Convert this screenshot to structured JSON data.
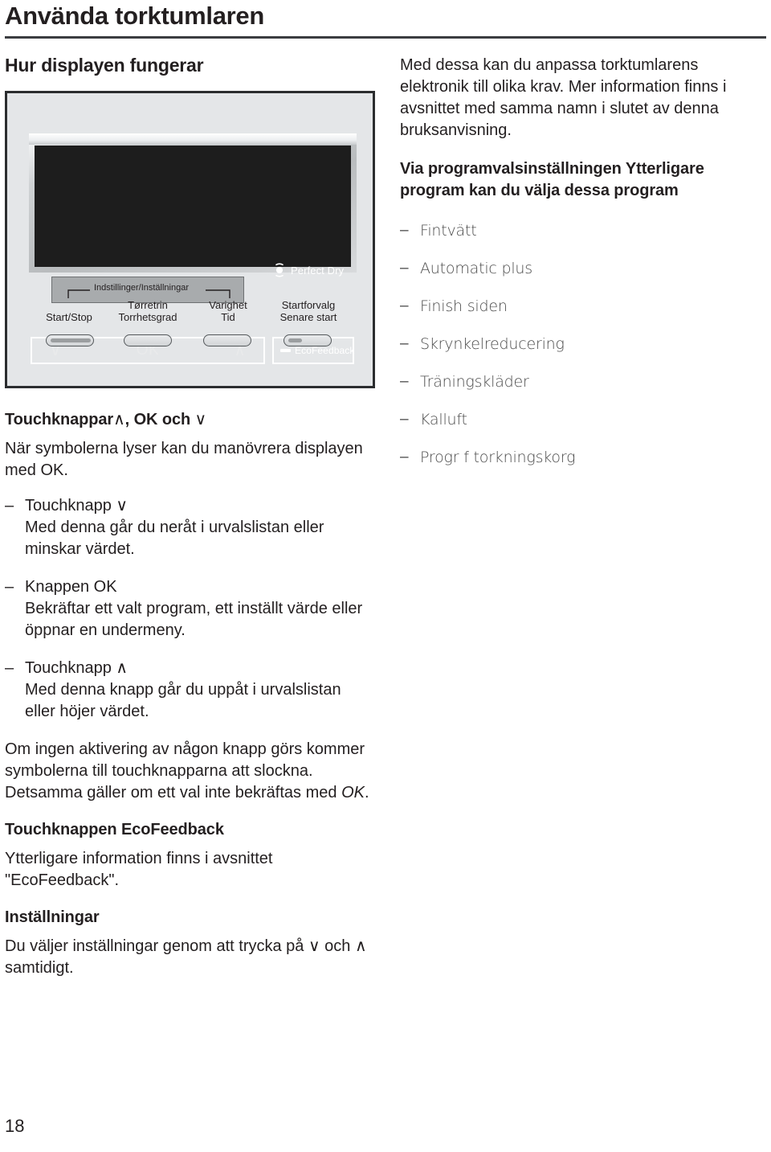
{
  "page": {
    "title": "Använda torktumlaren",
    "number": "18"
  },
  "left": {
    "heading": "Hur displayen fungerar",
    "illustration": {
      "perfect_dry_label": "Perfect Dry",
      "eco_feedback_label": "EcoFeedback",
      "touch_down": "∨",
      "touch_ok": "OK",
      "touch_up": "∧",
      "bracket_label": "Indstillinger/Inställningar",
      "controls": [
        {
          "line1": "",
          "line2": "Start/Stop"
        },
        {
          "line1": "Tørretrin",
          "line2": "Torrhetsgrad"
        },
        {
          "line1": "Varighet",
          "line2": "Tid"
        },
        {
          "line1": "Startforvalg",
          "line2": "Senare start"
        }
      ]
    },
    "touch_section": {
      "heading_bold_1": "Touchknappar",
      "heading_sym_1": "∧",
      "heading_bold_2": ", OK och ",
      "heading_sym_2": "∨",
      "intro": "När symbolerna lyser kan du manövrera displayen med OK.",
      "items": [
        {
          "title": "Touchknapp ∨",
          "body": "Med denna går du neråt i urvalslistan eller minskar värdet."
        },
        {
          "title_pre": "Knappen ",
          "title_bold": "OK",
          "body": "Bekräftar ett valt program, ett inställt värde eller öppnar en undermeny."
        },
        {
          "title": "Touchknapp ∧",
          "body": "Med denna knapp går du uppåt i urvalslistan eller höjer värdet."
        }
      ],
      "note_pre": "Om ingen aktivering av någon knapp görs kommer symbolerna till touchknapparna att slockna. Detsamma gäller om ett val inte bekräftas med ",
      "note_ital": "OK",
      "note_post": "."
    },
    "eco_section": {
      "heading": "Touchknappen EcoFeedback",
      "body": "Ytterligare information finns i avsnittet \"EcoFeedback\"."
    },
    "settings_section": {
      "heading": "Inställningar",
      "body_pre": "Du väljer inställningar genom att trycka på ",
      "sym1": "∨",
      "body_mid": " och ",
      "sym2": "∧",
      "body_post": " samtidigt."
    }
  },
  "right": {
    "intro": "Med dessa kan du anpassa torktumlarens elektronik till olika krav. Mer information finns i avsnittet med samma namn i slutet av denna bruksanvisning.",
    "programs_heading": "Via programvalsinställningen Ytterligare program kan du välja dessa program",
    "programs": [
      "Fintvätt",
      "Automatic plus",
      "Finish siden",
      "Skrynkelreducering",
      "Träningskläder",
      "Kalluft",
      "Progr f torkningskorg"
    ]
  },
  "colors": {
    "rule": "#3b3d40",
    "panel_dark": "#1d1d1d",
    "illustration_bg": "#e4e6e8",
    "lcd": "#a8abad",
    "program_text": "#4c4c4c"
  }
}
